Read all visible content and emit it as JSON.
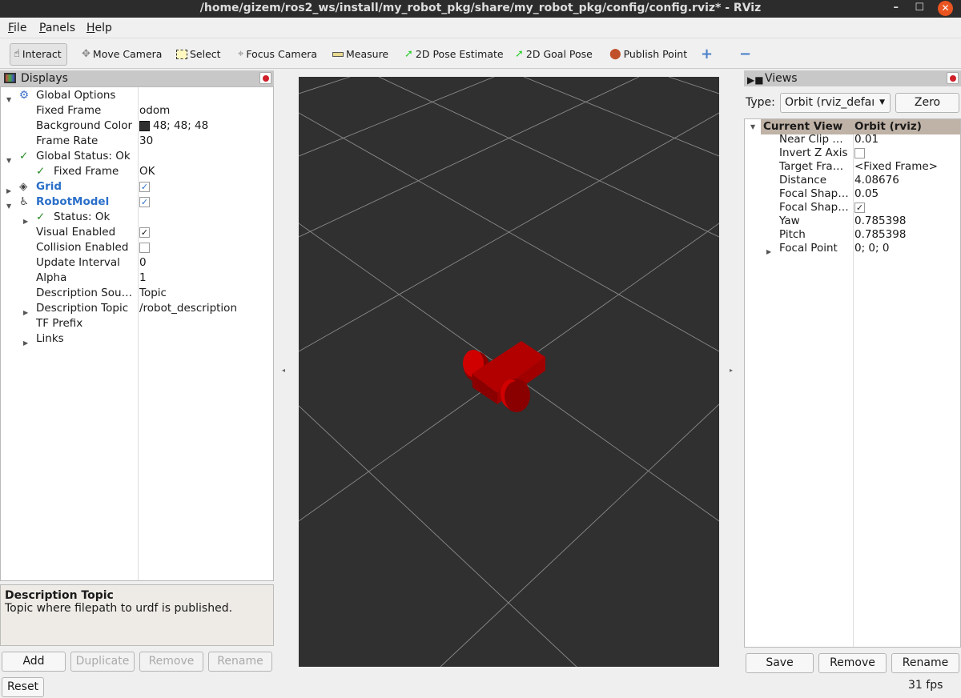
{
  "window": {
    "title": "/home/gizem/ros2_ws/install/my_robot_pkg/share/my_robot_pkg/config/config.rviz* - RViz",
    "minimize": "–",
    "maximize": "☐",
    "close": "✕"
  },
  "menu": [
    {
      "label": "File",
      "mn": "F",
      "rest": "ile"
    },
    {
      "label": "Panels",
      "mn": "P",
      "rest": "anels"
    },
    {
      "label": "Help",
      "mn": "H",
      "rest": "elp"
    }
  ],
  "toolbar": {
    "interact": "Interact",
    "move_camera": "Move Camera",
    "select": "Select",
    "focus_camera": "Focus Camera",
    "measure": "Measure",
    "pose_estimate": "2D Pose Estimate",
    "goal_pose": "2D Goal Pose",
    "publish_point": "Publish Point",
    "add_icon": "+",
    "remove_icon": "−"
  },
  "displays": {
    "title": "Displays",
    "rows": [
      {
        "key": "Global Options",
        "value": ""
      },
      {
        "key": "Fixed Frame",
        "value": "odom"
      },
      {
        "key": "Background Color",
        "value": "48; 48; 48",
        "swatch": "#303030"
      },
      {
        "key": "Frame Rate",
        "value": "30"
      },
      {
        "key": "Global Status: Ok",
        "value": ""
      },
      {
        "key": "Fixed Frame",
        "value": "OK"
      },
      {
        "key": "Grid",
        "value": "",
        "checked": true
      },
      {
        "key": "RobotModel",
        "value": "",
        "checked": true
      },
      {
        "key": "Status: Ok",
        "value": ""
      },
      {
        "key": "Visual Enabled",
        "value": "",
        "checked": true
      },
      {
        "key": "Collision Enabled",
        "value": "",
        "checked": false
      },
      {
        "key": "Update Interval",
        "value": "0"
      },
      {
        "key": "Alpha",
        "value": "1"
      },
      {
        "key": "Description Sou…",
        "value": "Topic"
      },
      {
        "key": "Description Topic",
        "value": "/robot_description"
      },
      {
        "key": "TF Prefix",
        "value": ""
      },
      {
        "key": "Links",
        "value": ""
      }
    ],
    "help_title": "Description Topic",
    "help_text": "Topic where filepath to urdf is published.",
    "buttons": {
      "add": "Add",
      "duplicate": "Duplicate",
      "remove": "Remove",
      "rename": "Rename",
      "reset": "Reset"
    }
  },
  "views": {
    "title": "Views",
    "type_label": "Type:",
    "type_value": "Orbit (rviz_defaı",
    "zero": "Zero",
    "header": {
      "key": "Current View",
      "value": "Orbit (rviz)"
    },
    "rows": [
      {
        "key": "Near Clip …",
        "value": "0.01"
      },
      {
        "key": "Invert Z Axis",
        "value": "",
        "checked": false
      },
      {
        "key": "Target Fra…",
        "value": "<Fixed Frame>"
      },
      {
        "key": "Distance",
        "value": "4.08676"
      },
      {
        "key": "Focal Shap…",
        "value": "0.05"
      },
      {
        "key": "Focal Shap…",
        "value": "",
        "checked": true
      },
      {
        "key": "Yaw",
        "value": "0.785398"
      },
      {
        "key": "Pitch",
        "value": "0.785398"
      },
      {
        "key": "Focal Point",
        "value": "0; 0; 0"
      }
    ],
    "buttons": {
      "save": "Save",
      "remove": "Remove",
      "rename": "Rename"
    }
  },
  "status": {
    "fps": "31 fps"
  },
  "colors": {
    "background": "#303030",
    "robot": "#b00000",
    "grid": "#a0a0a0"
  }
}
